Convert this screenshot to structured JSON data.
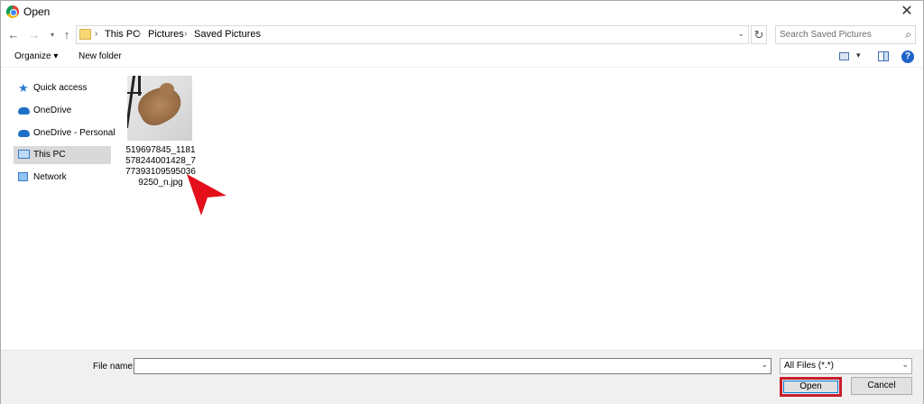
{
  "window": {
    "title": "Open",
    "close_glyph": "✕"
  },
  "nav": {
    "back_glyph": "←",
    "forward_glyph": "→",
    "recent_glyph": "▾",
    "up_glyph": "↑",
    "refresh_glyph": "↻"
  },
  "address": {
    "breadcrumbs": [
      "This PC",
      "Pictures",
      "Saved Pictures"
    ],
    "separator": "›",
    "dropdown_glyph": "⌄"
  },
  "search": {
    "placeholder": "Search Saved Pictures",
    "icon_glyph": "⌕"
  },
  "toolbar": {
    "organize_label": "Organize ▾",
    "new_folder_label": "New folder",
    "view_dropdown_glyph": "▾",
    "help_label": "?"
  },
  "sidebar": {
    "items": [
      {
        "label": "Quick access",
        "icon": "star-icon"
      },
      {
        "label": "OneDrive",
        "icon": "cloud-icon"
      },
      {
        "label": "OneDrive - Personal",
        "icon": "cloud-icon"
      },
      {
        "label": "This PC",
        "icon": "computer-icon",
        "selected": true
      },
      {
        "label": "Network",
        "icon": "network-icon"
      }
    ]
  },
  "files": [
    {
      "name": "519697845_1181578244001428_7773931095950369250_n.jpg",
      "thumbnail": "cat-photo"
    }
  ],
  "bottom": {
    "file_name_label": "File name:",
    "file_name_value": "",
    "file_type": "All Files (*.*)",
    "dropdown_glyph": "⌄",
    "open_label": "Open",
    "cancel_label": "Cancel"
  },
  "colors": {
    "highlight_red": "#c81e2a",
    "selection_gray": "#d9d9d9",
    "accent_blue": "#0078d7"
  }
}
